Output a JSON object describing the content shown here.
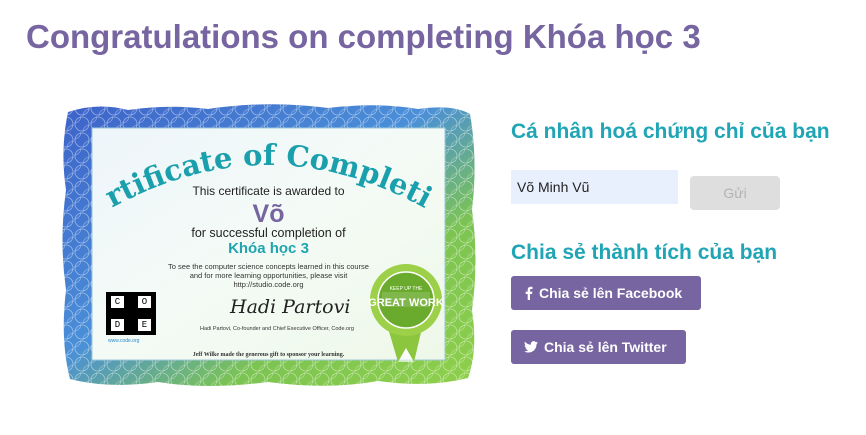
{
  "page": {
    "title": "Congratulations on completing Khóa học 3"
  },
  "certificate": {
    "heading": "Certificate of Completion",
    "awarded_text": "This certificate is awarded to",
    "recipient": "Võ",
    "completion_text": "for successful completion of",
    "course": "Khóa học 3",
    "info_line1": "To see the computer science concepts learned in this course",
    "info_line2": "and for more learning opportunities, please visit",
    "info_line3": "http://studio.code.org",
    "logo_letters": [
      "C",
      "O",
      "D",
      "E"
    ],
    "logo_url": "www.code.org",
    "signature": "Hadi Partovi",
    "signer_caption": "Hadi Partovi, Co-founder and Chief Executive Officer, Code.org",
    "sponsor_text": "Jeff Wilke made the generous gift to sponsor your learning.",
    "badge_top": "ANYONE CAN LEARN COMPUTER SCIENCE",
    "badge_bottom": "CODE.ORG",
    "badge_main": "GREAT WORK",
    "badge_small": "KEEP UP THE"
  },
  "personalize": {
    "heading": "Cá nhân hoá chứng chỉ của bạn",
    "name_value": "Võ Minh Vũ",
    "submit_label": "Gửi"
  },
  "share": {
    "heading": "Chia sẻ thành tích của bạn",
    "facebook_label": "Chia sẻ lên Facebook",
    "twitter_label": "Chia sẻ lên Twitter"
  },
  "colors": {
    "title": "#7665a0",
    "heading": "#1fa5b5",
    "button": "#7665a0",
    "disabled_button": "#dedede",
    "input_bg": "#e8f0fd"
  },
  "icons": {
    "facebook": "facebook-icon",
    "twitter": "twitter-icon"
  }
}
